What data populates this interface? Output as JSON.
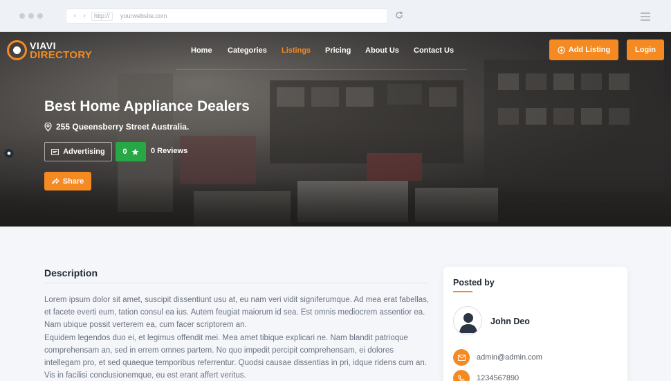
{
  "browser": {
    "protocol": "http://",
    "url": "yourwebsite.com"
  },
  "brand": {
    "line1": "VIAVI",
    "line2": "DIRECTORY",
    "accent_color": "#f48a21"
  },
  "nav": {
    "items": [
      {
        "label": "Home",
        "active": false
      },
      {
        "label": "Categories",
        "active": false
      },
      {
        "label": "Listings",
        "active": true
      },
      {
        "label": "Pricing",
        "active": false
      },
      {
        "label": "About Us",
        "active": false
      },
      {
        "label": "Contact Us",
        "active": false
      }
    ],
    "add_listing": "Add Listing",
    "login": "Login"
  },
  "listing": {
    "title": "Best Home Appliance Dealers",
    "address": "255 Queensberry Street Australia.",
    "category": "Advertising",
    "rating": "0",
    "reviews": "0 Reviews",
    "share": "Share",
    "rating_color": "#28a745"
  },
  "description": {
    "heading": "Description",
    "paragraph1": "Lorem ipsum dolor sit amet, suscipit dissentiunt usu at, eu nam veri vidit signiferumque. Ad mea erat fabellas, et facete everti eum, tation consul ea ius. Autem feugiat maiorum id sea. Est omnis mediocrem assentior ea. Nam ubique possit verterem ea, cum facer scriptorem an.",
    "paragraph2": "Equidem legendos duo ei, et legimus offendit mei. Mea amet tibique explicari ne. Nam blandit patrioque comprehensam an, sed in errem omnes partem. No quo impedit percipit comprehensam, ei dolores intellegam pro, et sed quaeque temporibus referrentur. Quodsi causae dissentias in pri, idque ridens cum an. Vis in facilisi conclusionemque, eu est erant affert veritus."
  },
  "posted_by": {
    "heading": "Posted by",
    "name": "John Deo",
    "email": "admin@admin.com",
    "phone": "1234567890"
  }
}
